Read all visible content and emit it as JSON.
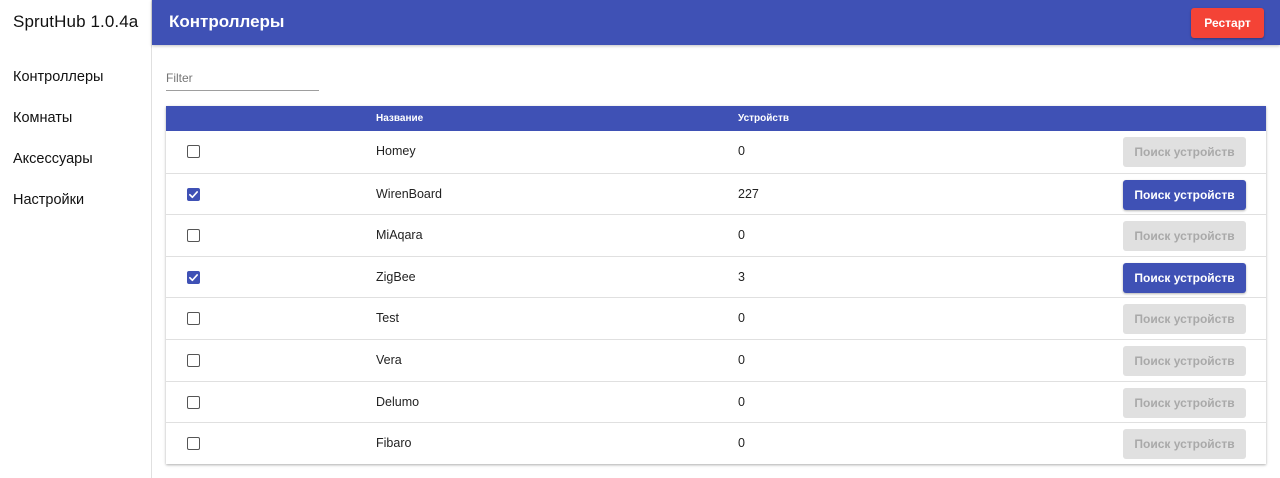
{
  "app": {
    "title": "SprutHub 1.0.4a"
  },
  "sidebar": {
    "items": [
      {
        "label": "Контроллеры"
      },
      {
        "label": "Комнаты"
      },
      {
        "label": "Аксессуары"
      },
      {
        "label": "Настройки"
      }
    ]
  },
  "header": {
    "title": "Контроллеры",
    "restart_label": "Рестарт"
  },
  "filter": {
    "placeholder": "Filter",
    "value": ""
  },
  "table": {
    "columns": {
      "name": "Название",
      "devices": "Устройств"
    },
    "search_label": "Поиск устройств",
    "rows": [
      {
        "checked": false,
        "name": "Homey",
        "devices": "0"
      },
      {
        "checked": true,
        "name": "WirenBoard",
        "devices": "227"
      },
      {
        "checked": false,
        "name": "MiAqara",
        "devices": "0"
      },
      {
        "checked": true,
        "name": "ZigBee",
        "devices": "3"
      },
      {
        "checked": false,
        "name": "Test",
        "devices": "0"
      },
      {
        "checked": false,
        "name": "Vera",
        "devices": "0"
      },
      {
        "checked": false,
        "name": "Delumo",
        "devices": "0"
      },
      {
        "checked": false,
        "name": "Fibaro",
        "devices": "0"
      }
    ]
  },
  "colors": {
    "primary": "#3f51b5",
    "danger": "#f44336",
    "disabled_bg": "#e0e0e0",
    "disabled_text": "#a9a9a9"
  },
  "icons": {
    "checkbox_checked": "check-icon"
  }
}
